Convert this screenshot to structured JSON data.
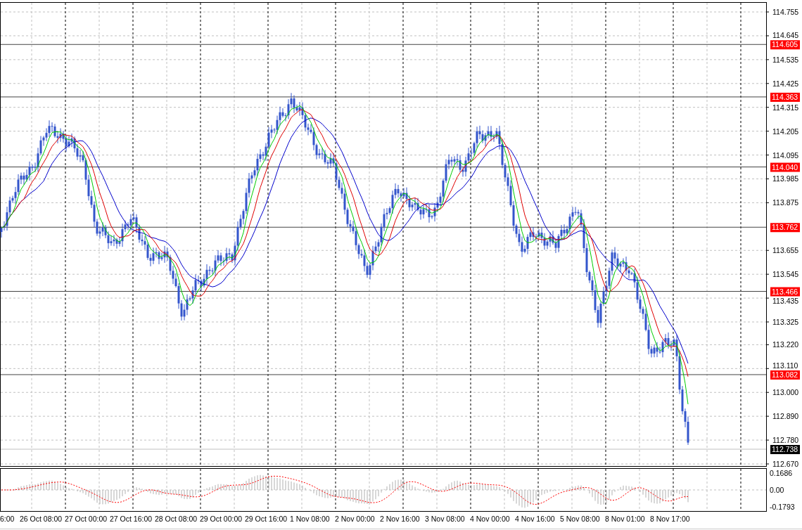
{
  "price_axis": {
    "labels": [
      "114.755",
      "114.645",
      "114.535",
      "114.425",
      "114.315",
      "114.205",
      "114.095",
      "113.985",
      "113.875",
      "113.655",
      "113.545",
      "113.435",
      "113.325",
      "113.220",
      "113.110",
      "113.000",
      "112.890",
      "112.780",
      "112.670"
    ]
  },
  "levels": [
    {
      "label": "114.605"
    },
    {
      "label": "114.363"
    },
    {
      "label": "114.040"
    },
    {
      "label": "113.762"
    },
    {
      "label": "113.466"
    },
    {
      "label": "113.082"
    }
  ],
  "current_price": {
    "label": "112.738"
  },
  "oscillator": {
    "labels": [
      "0.1686",
      "0.00",
      "-0.1793"
    ]
  },
  "time_axis": {
    "labels": [
      "6:00",
      "26 Oct 08:00",
      "27 Oct 00:00",
      "27 Oct 16:00",
      "28 Oct 08:00",
      "29 Oct 00:00",
      "29 Oct 16:00",
      "1 Nov 08:00",
      "2 Nov 00:00",
      "2 Nov 16:00",
      "3 Nov 08:00",
      "4 Nov 00:00",
      "4 Nov 16:00",
      "5 Nov 08:00",
      "8 Nov 01:00",
      "8 Nov 17:00"
    ]
  }
}
